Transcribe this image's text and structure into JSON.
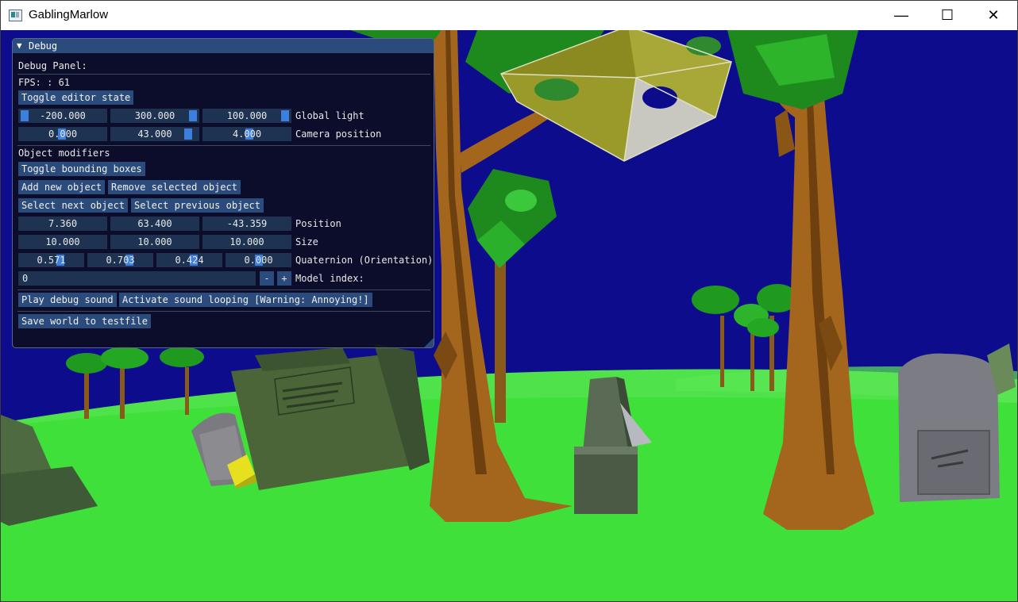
{
  "window": {
    "title": "GablingMarlow",
    "minimize_glyph": "—",
    "maximize_glyph": "☐",
    "close_glyph": "✕"
  },
  "icons": {
    "app": "app-icon",
    "collapse": "collapse-triangle-icon"
  },
  "debug": {
    "header_title": "Debug",
    "collapse_glyph": "▼",
    "panel_label": "Debug Panel:",
    "fps_text": "FPS: : 61",
    "toggle_editor": "Toggle editor state",
    "global_light": {
      "x": "-200.000",
      "y": "300.000",
      "z": "100.000",
      "label": "Global light"
    },
    "camera": {
      "x": "0.000",
      "y": "43.000",
      "z": "4.000",
      "label": "Camera position"
    },
    "object_modifiers": "Object modifiers",
    "toggle_bbox": "Toggle bounding boxes",
    "add_object": "Add new object",
    "remove_object": "Remove selected object",
    "select_next": "Select next object",
    "select_prev": "Select previous object",
    "position": {
      "x": "7.360",
      "y": "63.400",
      "z": "-43.359",
      "label": "Position"
    },
    "size": {
      "x": "10.000",
      "y": "10.000",
      "z": "10.000",
      "label": "Size"
    },
    "quaternion": {
      "x": "0.571",
      "y": "0.703",
      "z": "0.424",
      "w": "0.000",
      "label": "Quaternion (Orientation)"
    },
    "model_index": {
      "value": "0",
      "minus": "-",
      "plus": "+",
      "label": "Model index:"
    },
    "play_sound": "Play debug sound",
    "loop_sound": "Activate sound looping [Warning: Annoying!]",
    "save_world": "Save world to testfile"
  },
  "colors": {
    "sky": "#0c0c8c",
    "grass": "#3fe03a",
    "panel_header": "#2a4b7c",
    "slider_grab": "#3d7fdc"
  }
}
